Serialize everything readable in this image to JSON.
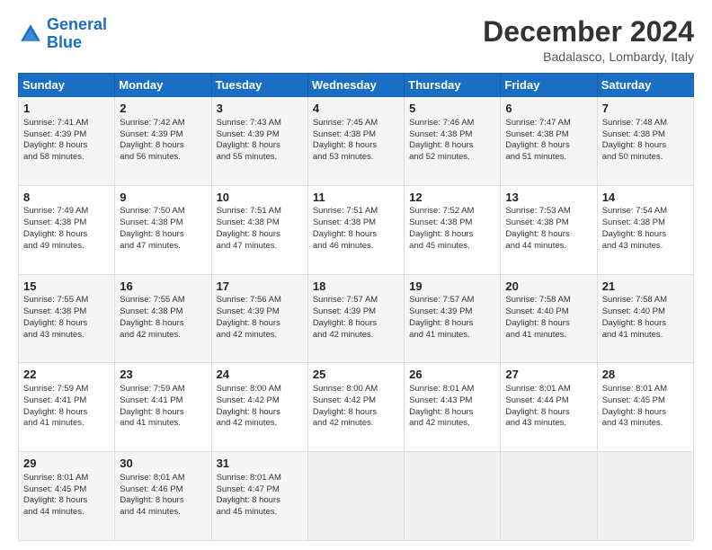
{
  "header": {
    "logo_line1": "General",
    "logo_line2": "Blue",
    "month_title": "December 2024",
    "location": "Badalasco, Lombardy, Italy"
  },
  "weekdays": [
    "Sunday",
    "Monday",
    "Tuesday",
    "Wednesday",
    "Thursday",
    "Friday",
    "Saturday"
  ],
  "weeks": [
    [
      {
        "day": "1",
        "lines": [
          "Sunrise: 7:41 AM",
          "Sunset: 4:39 PM",
          "Daylight: 8 hours",
          "and 58 minutes."
        ]
      },
      {
        "day": "2",
        "lines": [
          "Sunrise: 7:42 AM",
          "Sunset: 4:39 PM",
          "Daylight: 8 hours",
          "and 56 minutes."
        ]
      },
      {
        "day": "3",
        "lines": [
          "Sunrise: 7:43 AM",
          "Sunset: 4:39 PM",
          "Daylight: 8 hours",
          "and 55 minutes."
        ]
      },
      {
        "day": "4",
        "lines": [
          "Sunrise: 7:45 AM",
          "Sunset: 4:38 PM",
          "Daylight: 8 hours",
          "and 53 minutes."
        ]
      },
      {
        "day": "5",
        "lines": [
          "Sunrise: 7:46 AM",
          "Sunset: 4:38 PM",
          "Daylight: 8 hours",
          "and 52 minutes."
        ]
      },
      {
        "day": "6",
        "lines": [
          "Sunrise: 7:47 AM",
          "Sunset: 4:38 PM",
          "Daylight: 8 hours",
          "and 51 minutes."
        ]
      },
      {
        "day": "7",
        "lines": [
          "Sunrise: 7:48 AM",
          "Sunset: 4:38 PM",
          "Daylight: 8 hours",
          "and 50 minutes."
        ]
      }
    ],
    [
      {
        "day": "8",
        "lines": [
          "Sunrise: 7:49 AM",
          "Sunset: 4:38 PM",
          "Daylight: 8 hours",
          "and 49 minutes."
        ]
      },
      {
        "day": "9",
        "lines": [
          "Sunrise: 7:50 AM",
          "Sunset: 4:38 PM",
          "Daylight: 8 hours",
          "and 47 minutes."
        ]
      },
      {
        "day": "10",
        "lines": [
          "Sunrise: 7:51 AM",
          "Sunset: 4:38 PM",
          "Daylight: 8 hours",
          "and 47 minutes."
        ]
      },
      {
        "day": "11",
        "lines": [
          "Sunrise: 7:51 AM",
          "Sunset: 4:38 PM",
          "Daylight: 8 hours",
          "and 46 minutes."
        ]
      },
      {
        "day": "12",
        "lines": [
          "Sunrise: 7:52 AM",
          "Sunset: 4:38 PM",
          "Daylight: 8 hours",
          "and 45 minutes."
        ]
      },
      {
        "day": "13",
        "lines": [
          "Sunrise: 7:53 AM",
          "Sunset: 4:38 PM",
          "Daylight: 8 hours",
          "and 44 minutes."
        ]
      },
      {
        "day": "14",
        "lines": [
          "Sunrise: 7:54 AM",
          "Sunset: 4:38 PM",
          "Daylight: 8 hours",
          "and 43 minutes."
        ]
      }
    ],
    [
      {
        "day": "15",
        "lines": [
          "Sunrise: 7:55 AM",
          "Sunset: 4:38 PM",
          "Daylight: 8 hours",
          "and 43 minutes."
        ]
      },
      {
        "day": "16",
        "lines": [
          "Sunrise: 7:55 AM",
          "Sunset: 4:38 PM",
          "Daylight: 8 hours",
          "and 42 minutes."
        ]
      },
      {
        "day": "17",
        "lines": [
          "Sunrise: 7:56 AM",
          "Sunset: 4:39 PM",
          "Daylight: 8 hours",
          "and 42 minutes."
        ]
      },
      {
        "day": "18",
        "lines": [
          "Sunrise: 7:57 AM",
          "Sunset: 4:39 PM",
          "Daylight: 8 hours",
          "and 42 minutes."
        ]
      },
      {
        "day": "19",
        "lines": [
          "Sunrise: 7:57 AM",
          "Sunset: 4:39 PM",
          "Daylight: 8 hours",
          "and 41 minutes."
        ]
      },
      {
        "day": "20",
        "lines": [
          "Sunrise: 7:58 AM",
          "Sunset: 4:40 PM",
          "Daylight: 8 hours",
          "and 41 minutes."
        ]
      },
      {
        "day": "21",
        "lines": [
          "Sunrise: 7:58 AM",
          "Sunset: 4:40 PM",
          "Daylight: 8 hours",
          "and 41 minutes."
        ]
      }
    ],
    [
      {
        "day": "22",
        "lines": [
          "Sunrise: 7:59 AM",
          "Sunset: 4:41 PM",
          "Daylight: 8 hours",
          "and 41 minutes."
        ]
      },
      {
        "day": "23",
        "lines": [
          "Sunrise: 7:59 AM",
          "Sunset: 4:41 PM",
          "Daylight: 8 hours",
          "and 41 minutes."
        ]
      },
      {
        "day": "24",
        "lines": [
          "Sunrise: 8:00 AM",
          "Sunset: 4:42 PM",
          "Daylight: 8 hours",
          "and 42 minutes."
        ]
      },
      {
        "day": "25",
        "lines": [
          "Sunrise: 8:00 AM",
          "Sunset: 4:42 PM",
          "Daylight: 8 hours",
          "and 42 minutes."
        ]
      },
      {
        "day": "26",
        "lines": [
          "Sunrise: 8:01 AM",
          "Sunset: 4:43 PM",
          "Daylight: 8 hours",
          "and 42 minutes."
        ]
      },
      {
        "day": "27",
        "lines": [
          "Sunrise: 8:01 AM",
          "Sunset: 4:44 PM",
          "Daylight: 8 hours",
          "and 43 minutes."
        ]
      },
      {
        "day": "28",
        "lines": [
          "Sunrise: 8:01 AM",
          "Sunset: 4:45 PM",
          "Daylight: 8 hours",
          "and 43 minutes."
        ]
      }
    ],
    [
      {
        "day": "29",
        "lines": [
          "Sunrise: 8:01 AM",
          "Sunset: 4:45 PM",
          "Daylight: 8 hours",
          "and 44 minutes."
        ]
      },
      {
        "day": "30",
        "lines": [
          "Sunrise: 8:01 AM",
          "Sunset: 4:46 PM",
          "Daylight: 8 hours",
          "and 44 minutes."
        ]
      },
      {
        "day": "31",
        "lines": [
          "Sunrise: 8:01 AM",
          "Sunset: 4:47 PM",
          "Daylight: 8 hours",
          "and 45 minutes."
        ]
      },
      {
        "day": "",
        "lines": []
      },
      {
        "day": "",
        "lines": []
      },
      {
        "day": "",
        "lines": []
      },
      {
        "day": "",
        "lines": []
      }
    ]
  ]
}
